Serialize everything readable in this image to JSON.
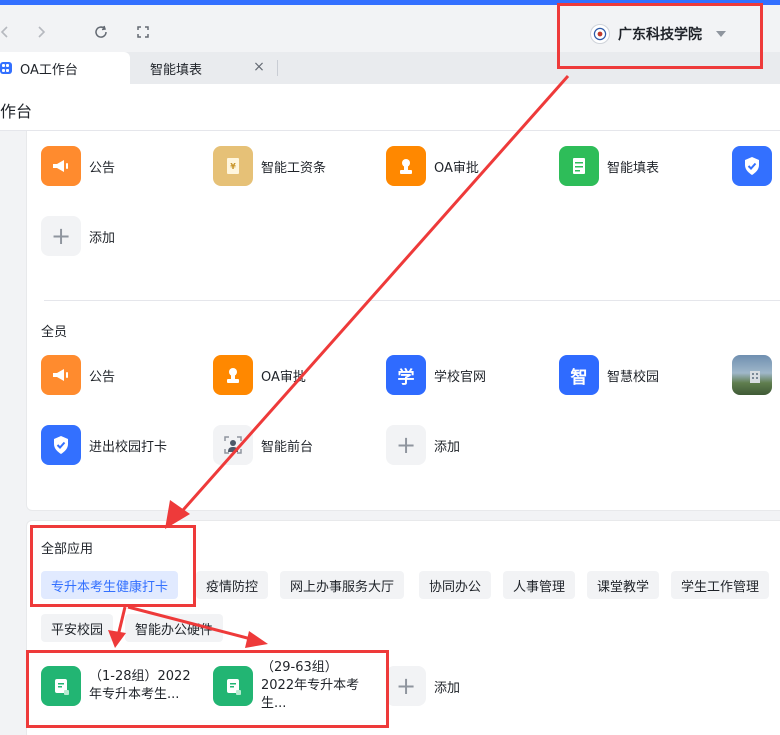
{
  "browser": {
    "org_name": "广东科技学院"
  },
  "tabs": [
    {
      "label": "OA工作台"
    },
    {
      "label": "智能填表",
      "close": "×"
    }
  ],
  "page": {
    "title": "作台"
  },
  "common_apps": [
    {
      "label": "公告",
      "icon": "megaphone-icon",
      "color": "#ff8b2e"
    },
    {
      "label": "智能工资条",
      "icon": "salary-slip-icon",
      "color": "#e6c177"
    },
    {
      "label": "OA审批",
      "icon": "stamp-icon",
      "color": "#ff8800"
    },
    {
      "label": "智能填表",
      "icon": "form-icon",
      "color": "#2ebd59"
    },
    {
      "label": "",
      "icon": "shield-check-icon",
      "color": "#3370ff"
    },
    {
      "label": "添加",
      "icon": "plus-icon"
    }
  ],
  "all_members": {
    "title": "全员",
    "apps": [
      {
        "label": "公告",
        "icon": "megaphone-icon",
        "color": "#ff8b2e"
      },
      {
        "label": "OA审批",
        "icon": "stamp-icon",
        "color": "#ff8800"
      },
      {
        "label": "学校官网",
        "icon": "xue-icon",
        "glyph": "学",
        "color": "#2f6bff"
      },
      {
        "label": "智慧校园",
        "icon": "zhi-icon",
        "glyph": "智",
        "color": "#2f6bff"
      },
      {
        "label": "",
        "icon": "campus-photo-icon"
      },
      {
        "label": "进出校园打卡",
        "icon": "shield-check-icon",
        "color": "#3370ff"
      },
      {
        "label": "智能前台",
        "icon": "front-desk-icon"
      },
      {
        "label": "添加",
        "icon": "plus-icon"
      }
    ]
  },
  "all_apps": {
    "title": "全部应用",
    "categories": [
      {
        "label": "专升本考生健康打卡",
        "selected": true
      },
      {
        "label": "疫情防控"
      },
      {
        "label": "网上办事服务大厅"
      },
      {
        "label": "协同办公"
      },
      {
        "label": "人事管理"
      },
      {
        "label": "课堂教学"
      },
      {
        "label": "学生工作管理"
      },
      {
        "label": "平安校园"
      },
      {
        "label": "智能办公硬件"
      }
    ],
    "apps": [
      {
        "label": "（1-28组）2022年专升本考生...",
        "icon": "document-icon",
        "color": "#22b573"
      },
      {
        "label": "（29-63组）2022年专升本考生...",
        "icon": "document-icon",
        "color": "#22b573"
      },
      {
        "label": "添加",
        "icon": "plus-icon"
      }
    ]
  },
  "annotation_color": "#ee3a3a"
}
